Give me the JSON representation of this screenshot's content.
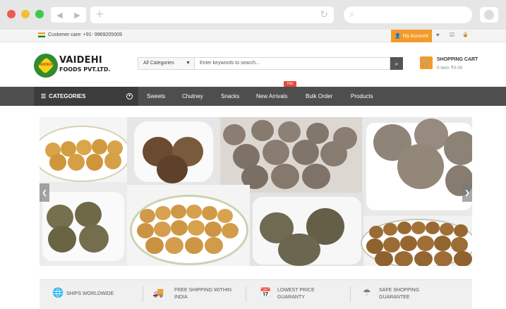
{
  "browser": {
    "nav_back": "◀",
    "nav_forward": "▶",
    "new_tab": "+",
    "reload": "↻",
    "search_icon": "⌕"
  },
  "topbar": {
    "customer_care": "Customer care: +91- 9969205009",
    "account": "My Account",
    "wishlist_icon": "♥",
    "compare_icon": "☑",
    "lock_icon": "🔒"
  },
  "header": {
    "logo_mark": "VAIDEHI",
    "logo_name": "VAIDEHI",
    "logo_sub": "FOODS PVT.LTD.",
    "category_select": "All Categories",
    "search_placeholder": "Enter keywords to search...",
    "cart_title": "SHOPPING CART",
    "cart_count": "0 item ₹0.00"
  },
  "menu": {
    "categories": "CATEGORIES",
    "items": [
      "Sweets",
      "Chutney",
      "Snacks",
      "New Arrivals",
      "Bulk Order",
      "Products"
    ],
    "hot_badge": "Hot"
  },
  "slider": {
    "prev": "❮",
    "next": "❯"
  },
  "features": [
    {
      "label": "SHIPS WORLDWIDE",
      "icon": "globe-icon"
    },
    {
      "label": "FREE SHIPPING WITHIN\nINDIA",
      "icon": "truck-icon"
    },
    {
      "label": "LOWEST PRICE\nGUARANTY",
      "icon": "calendar-icon"
    },
    {
      "label": "SAFE SHOPPING\nGUARANTEE",
      "icon": "umbrella-icon"
    }
  ],
  "colors": {
    "accent": "#f39a2b",
    "menu_bg": "#4e4e4e",
    "hot": "#e54b3c"
  }
}
